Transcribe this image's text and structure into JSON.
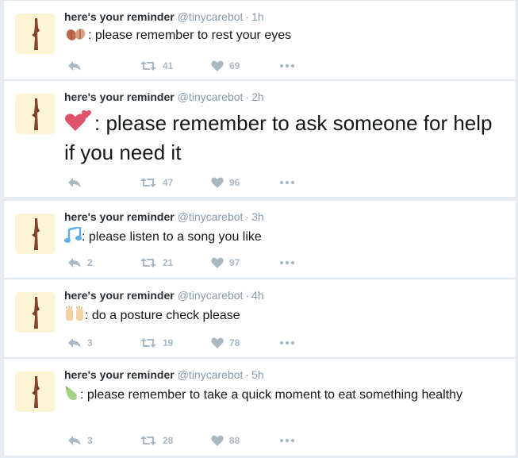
{
  "author": {
    "name": "here's your reminder",
    "handle": "@tinycarebot",
    "separator": "·"
  },
  "colors": {
    "background": "#e6ecf0",
    "card": "#ffffff",
    "name": "#292f33",
    "meta": "#8899a6",
    "action_icons": "#aab8c2"
  },
  "tweets": [
    {
      "time": "1h",
      "emoji": "fallen-leaves",
      "text": ": please remember to rest your eyes",
      "replies": "",
      "retweets": "41",
      "likes": "69"
    },
    {
      "time": "2h",
      "emoji": "two-hearts",
      "text": ": please remember to ask someone for help if you need it",
      "replies": "",
      "retweets": "47",
      "likes": "96"
    },
    {
      "time": "3h",
      "emoji": "musical-notes",
      "text": ": please listen to a song you like",
      "replies": "2",
      "retweets": "21",
      "likes": "97"
    },
    {
      "time": "4h",
      "emoji": "raised-hands",
      "text": ": do a posture check please",
      "replies": "3",
      "retweets": "19",
      "likes": "78"
    },
    {
      "time": "5h",
      "emoji": "pear",
      "text": ": please remember to take a quick moment to eat something healthy",
      "replies": "3",
      "retweets": "28",
      "likes": "88"
    }
  ]
}
